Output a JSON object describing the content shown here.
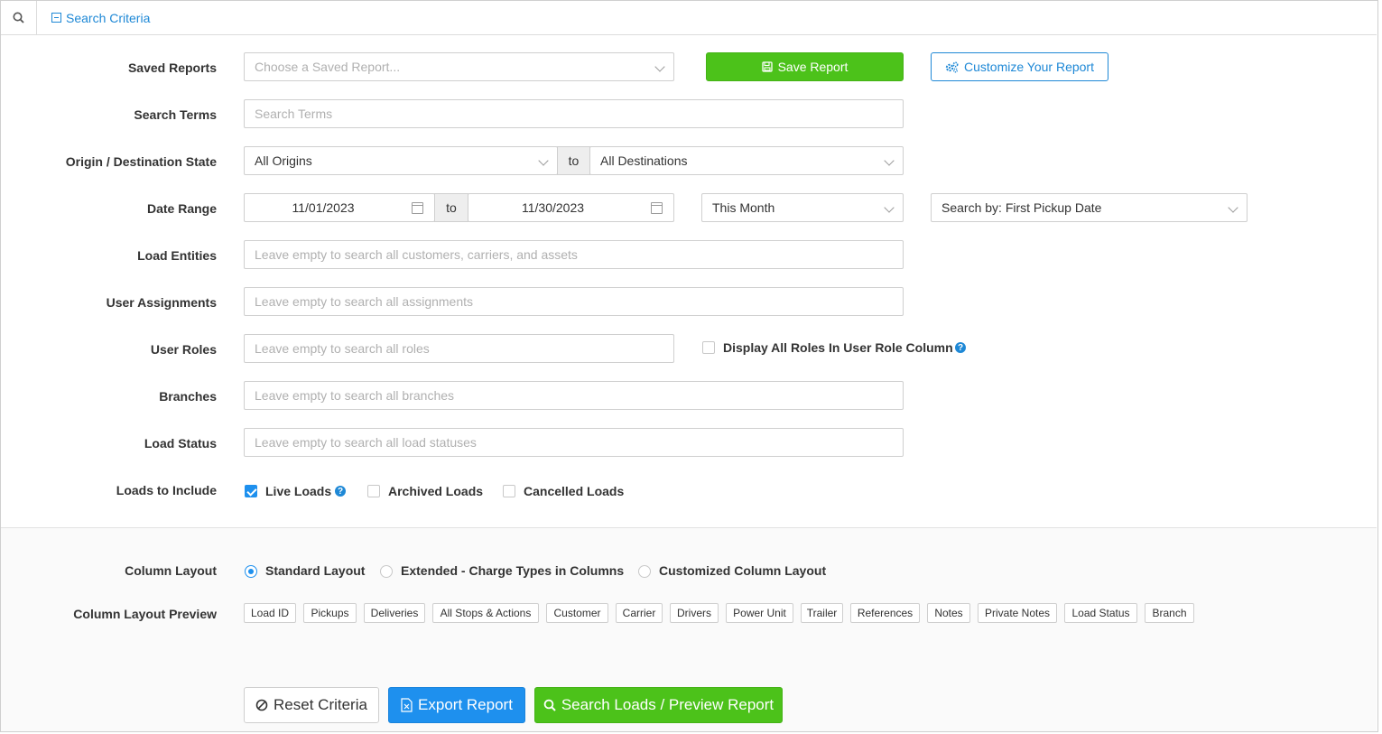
{
  "header": {
    "criteria_label": "Search Criteria"
  },
  "labels": {
    "saved_reports": "Saved Reports",
    "search_terms": "Search Terms",
    "origin_destination": "Origin / Destination State",
    "date_range": "Date Range",
    "load_entities": "Load Entities",
    "user_assignments": "User Assignments",
    "user_roles": "User Roles",
    "branches": "Branches",
    "load_status": "Load Status",
    "loads_to_include": "Loads to Include",
    "column_layout": "Column Layout",
    "column_layout_preview": "Column Layout Preview"
  },
  "saved_reports": {
    "placeholder": "Choose a Saved Report...",
    "save_label": "Save Report",
    "customize_label": "Customize Your Report"
  },
  "search_terms": {
    "placeholder": "Search Terms"
  },
  "origin_destination": {
    "origin": "All Origins",
    "to": "to",
    "destination": "All Destinations"
  },
  "date_range": {
    "start": "11/01/2023",
    "to": "to",
    "end": "11/30/2023",
    "preset": "This Month",
    "search_by": "Search by: First Pickup Date"
  },
  "placeholders": {
    "load_entities": "Leave empty to search all customers, carriers, and assets",
    "user_assignments": "Leave empty to search all assignments",
    "user_roles": "Leave empty to search all roles",
    "branches": "Leave empty to search all branches",
    "load_status": "Leave empty to search all load statuses"
  },
  "user_roles": {
    "display_all_label": "Display All Roles In User Role Column",
    "display_all_checked": false
  },
  "loads_to_include": [
    {
      "label": "Live Loads",
      "checked": true
    },
    {
      "label": "Archived Loads",
      "checked": false
    },
    {
      "label": "Cancelled Loads",
      "checked": false
    }
  ],
  "column_layout": {
    "options": [
      "Standard Layout",
      "Extended - Charge Types in Columns",
      "Customized Column Layout"
    ],
    "selected": "Standard Layout"
  },
  "column_preview": [
    "Load ID",
    "Pickups",
    "Deliveries",
    "All Stops & Actions",
    "Customer",
    "Carrier",
    "Drivers",
    "Power Unit",
    "Trailer",
    "References",
    "Notes",
    "Private Notes",
    "Load Status",
    "Branch"
  ],
  "footer": {
    "reset_label": "Reset Criteria",
    "export_label": "Export Report",
    "search_label": "Search Loads / Preview Report"
  },
  "colors": {
    "accent_blue": "#1e88d6",
    "green": "#4cc21a",
    "primary_blue": "#1e90ee"
  }
}
